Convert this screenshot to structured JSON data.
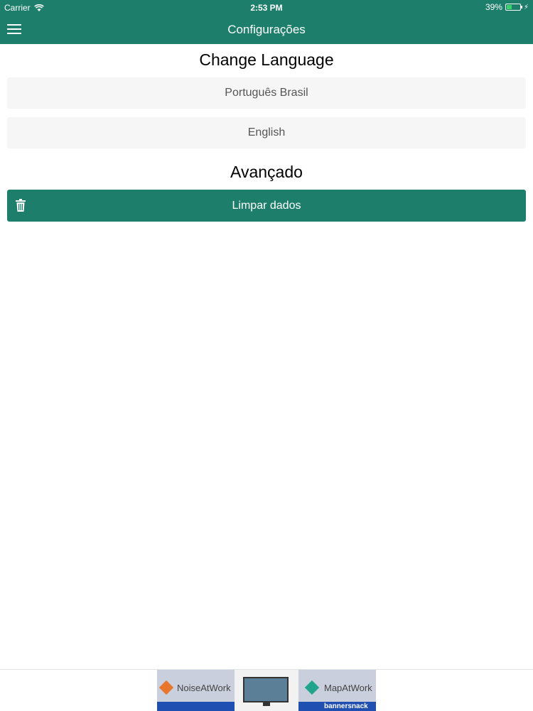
{
  "status_bar": {
    "carrier": "Carrier",
    "time": "2:53 PM",
    "battery_percent": "39%",
    "battery_level": 0.39,
    "icons": [
      "wifi-icon",
      "battery-icon",
      "charging-bolt-icon"
    ]
  },
  "header": {
    "title": "Configurações",
    "menu_icon": "hamburger-menu-icon",
    "background_color": "#1d7f6b"
  },
  "language_section": {
    "title": "Change Language",
    "options": [
      "Português Brasil",
      "English"
    ]
  },
  "advanced_section": {
    "title": "Avançado",
    "clear_button": {
      "label": "Limpar dados",
      "icon": "trash-icon",
      "color": "#1d7f6b"
    }
  },
  "ad_banner": {
    "left_text": "NoiseAtWork",
    "right_text": "MapAtWork",
    "brand": "bannersnack"
  }
}
